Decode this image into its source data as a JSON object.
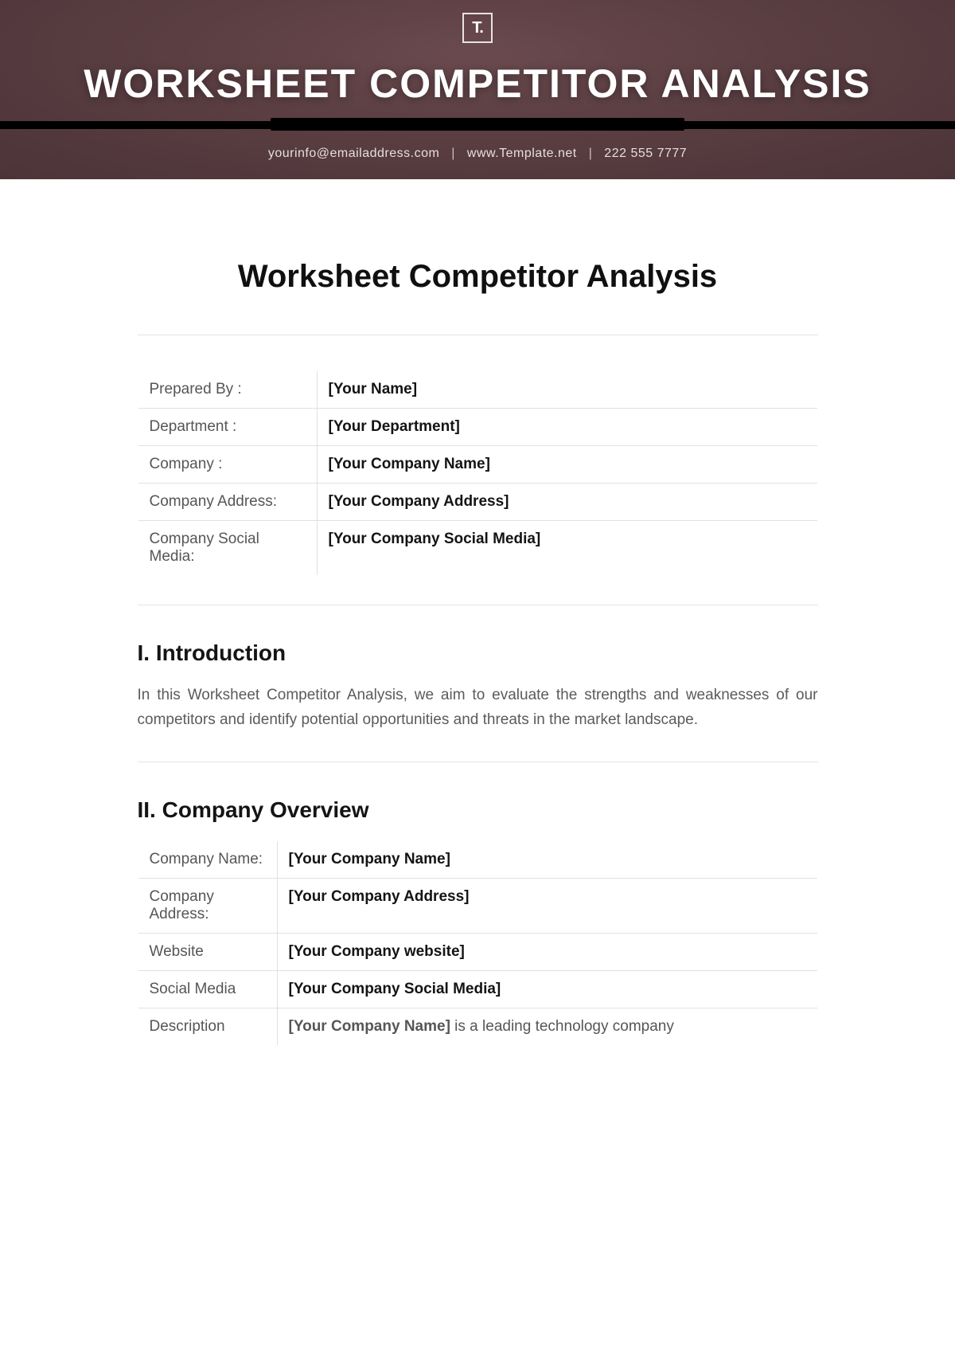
{
  "banner": {
    "logo_text": "T.",
    "title": "WORKSHEET COMPETITOR ANALYSIS",
    "email": "yourinfo@emailaddress.com",
    "website": "www.Template.net",
    "phone": "222 555 7777"
  },
  "doc": {
    "title": "Worksheet Competitor Analysis",
    "prepared_rows": [
      {
        "label": "Prepared By :",
        "value": "[Your Name]"
      },
      {
        "label": "Department :",
        "value": "[Your Department]"
      },
      {
        "label": "Company :",
        "value": "[Your Company Name]"
      },
      {
        "label": "Company Address:",
        "value": "[Your Company Address]"
      },
      {
        "label": "Company Social Media:",
        "value": "[Your Company Social Media]"
      }
    ],
    "section1": {
      "heading": "I. Introduction",
      "body": "In this Worksheet Competitor Analysis, we aim to evaluate the strengths and weaknesses of our competitors and identify potential opportunities and threats in the market landscape."
    },
    "section2": {
      "heading": "II. Company Overview",
      "rows": [
        {
          "label": "Company Name:",
          "value": "[Your Company Name]"
        },
        {
          "label": "Company Address:",
          "value": "[Your Company Address]"
        },
        {
          "label": "Website",
          "value": "[Your Company website]"
        },
        {
          "label": "Social Media",
          "value": "[Your Company Social Media]"
        },
        {
          "label": "Description",
          "value_prefix_bold": "[Your Company Name]",
          "value_rest": " is a leading technology company"
        }
      ]
    }
  }
}
